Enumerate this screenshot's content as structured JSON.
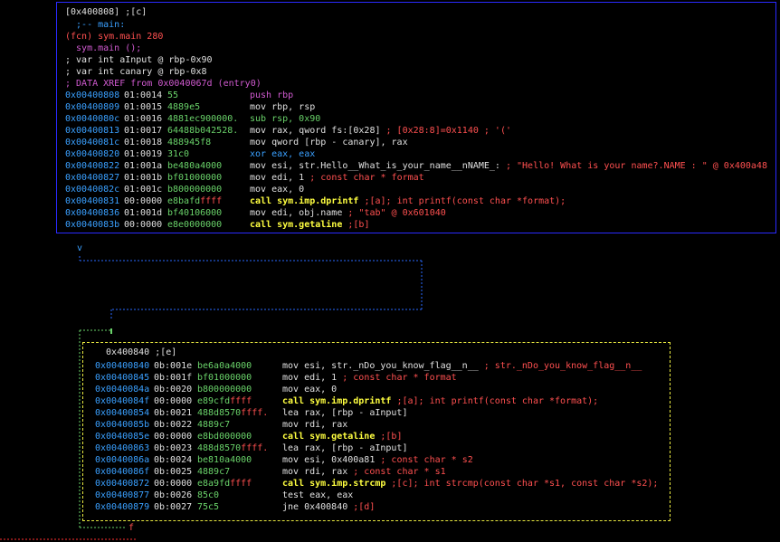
{
  "block1": {
    "header": "[0x400808] ;[c]",
    "main_label": "  ;-- main:",
    "fcn_line": "(fcn) sym.main 280",
    "sym_line": "  sym.main ();",
    "var1": "; var int aInput @ rbp-0x90",
    "var2": "; var int canary @ rbp-0x8",
    "xref": "; DATA XREF from 0x0040067d (entry0)",
    "rows": [
      {
        "addr": "0x00400808",
        "off": "01:0014",
        "bytes": "55",
        "ff": "",
        "mn": "push rbp",
        "mnclass": "c-mn-push",
        "cmt": ""
      },
      {
        "addr": "0x00400809",
        "off": "01:0015",
        "bytes": "4889e5",
        "ff": "",
        "mn": "mov rbp, rsp",
        "mnclass": "c-mn",
        "cmt": ""
      },
      {
        "addr": "0x0040080c",
        "off": "01:0016",
        "bytes": "4881ec900000.",
        "ff": "",
        "mn": "sub rsp, 0x90",
        "mnclass": "c-mn-sub",
        "cmt": ""
      },
      {
        "addr": "0x00400813",
        "off": "01:0017",
        "bytes": "64488b042528.",
        "ff": "",
        "mn": "mov rax, qword fs:[0x28]",
        "mnclass": "c-mn",
        "cmt": " ; [0x28:8]=0x1140 ; '('"
      },
      {
        "addr": "0x0040081c",
        "off": "01:0018",
        "bytes": "488945f8",
        "ff": "",
        "mn": "mov qword [rbp - canary], rax",
        "mnclass": "c-mn",
        "cmt": ""
      },
      {
        "addr": "0x00400820",
        "off": "01:0019",
        "bytes": "31c0",
        "ff": "",
        "mn": "xor eax, eax",
        "mnclass": "c-mn-xor",
        "cmt": ""
      },
      {
        "addr": "0x00400822",
        "off": "01:001a",
        "bytes": "be480a4000",
        "ff": "",
        "mn": "mov esi, str.Hello__What_is_your_name__nNAME_:",
        "mnclass": "c-mn",
        "cmt": " ; \"Hello! What is your name?.NAME : \" @ 0x400a48"
      },
      {
        "addr": "0x00400827",
        "off": "01:001b",
        "bytes": "bf01000000",
        "ff": "",
        "mn": "mov edi, 1",
        "mnclass": "c-mn",
        "cmt": " ; const char * format"
      },
      {
        "addr": "0x0040082c",
        "off": "01:001c",
        "bytes": "b800000000",
        "ff": "",
        "mn": "mov eax, 0",
        "mnclass": "c-mn",
        "cmt": ""
      },
      {
        "addr": "0x00400831",
        "off": "00:0000",
        "bytes": "e8bafd",
        "ff": "ffff",
        "mn": "call sym.imp.dprintf",
        "mnclass": "c-call",
        "cmt": " ;[a]; int printf(const char *format);"
      },
      {
        "addr": "0x00400836",
        "off": "01:001d",
        "bytes": "bf40106000",
        "ff": "",
        "mn": "mov edi, obj.name",
        "mnclass": "c-mn",
        "cmt": " ; \"tab\" @ 0x601040"
      },
      {
        "addr": "0x0040083b",
        "off": "00:0000",
        "bytes": "e8e0000000",
        "ff": "",
        "mn": "call sym.getaline",
        "mnclass": "c-call",
        "cmt": " ;[b]"
      }
    ]
  },
  "connector": {
    "v_label": "v",
    "f_label": "f"
  },
  "block2": {
    "header": "  0x400840 ;[e]",
    "rows": [
      {
        "addr": "0x00400840",
        "off": "0b:001e",
        "bytes": "be6a0a4000",
        "ff": "",
        "mn": "mov esi, str._nDo_you_know_flag__n__",
        "mnclass": "c-mn",
        "cmt": " ; str._nDo_you_know_flag__n__"
      },
      {
        "addr": "0x00400845",
        "off": "0b:001f",
        "bytes": "bf01000000",
        "ff": "",
        "mn": "mov edi, 1",
        "mnclass": "c-mn",
        "cmt": " ; const char * format"
      },
      {
        "addr": "0x0040084a",
        "off": "0b:0020",
        "bytes": "b800000000",
        "ff": "",
        "mn": "mov eax, 0",
        "mnclass": "c-mn",
        "cmt": ""
      },
      {
        "addr": "0x0040084f",
        "off": "00:0000",
        "bytes": "e89cfd",
        "ff": "ffff",
        "mn": "call sym.imp.dprintf",
        "mnclass": "c-call",
        "cmt": " ;[a]; int printf(const char *format);"
      },
      {
        "addr": "0x00400854",
        "off": "0b:0021",
        "bytes": "488d8570",
        "ff": "ffff.",
        "mn": "lea rax, [rbp - aInput]",
        "mnclass": "c-mn",
        "cmt": ""
      },
      {
        "addr": "0x0040085b",
        "off": "0b:0022",
        "bytes": "4889c7",
        "ff": "",
        "mn": "mov rdi, rax",
        "mnclass": "c-mn",
        "cmt": ""
      },
      {
        "addr": "0x0040085e",
        "off": "00:0000",
        "bytes": "e8bd000000",
        "ff": "",
        "mn": "call sym.getaline",
        "mnclass": "c-call",
        "cmt": " ;[b]"
      },
      {
        "addr": "0x00400863",
        "off": "0b:0023",
        "bytes": "488d8570",
        "ff": "ffff.",
        "mn": "lea rax, [rbp - aInput]",
        "mnclass": "c-mn",
        "cmt": ""
      },
      {
        "addr": "0x0040086a",
        "off": "0b:0024",
        "bytes": "be810a4000",
        "ff": "",
        "mn": "mov esi, 0x400a81",
        "mnclass": "c-mn",
        "cmt": " ; const char * s2"
      },
      {
        "addr": "0x0040086f",
        "off": "0b:0025",
        "bytes": "4889c7",
        "ff": "",
        "mn": "mov rdi, rax",
        "mnclass": "c-mn",
        "cmt": " ; const char * s1"
      },
      {
        "addr": "0x00400872",
        "off": "00:0000",
        "bytes": "e8a9fd",
        "ff": "ffff",
        "mn": "call sym.imp.strcmp",
        "mnclass": "c-call",
        "cmt": " ;[c]; int strcmp(const char *s1, const char *s2);"
      },
      {
        "addr": "0x00400877",
        "off": "0b:0026",
        "bytes": "85c0",
        "ff": "",
        "mn": "test eax, eax",
        "mnclass": "c-mn",
        "cmt": ""
      },
      {
        "addr": "0x00400879",
        "off": "0b:0027",
        "bytes": "75c5",
        "ff": "",
        "mn": "jne 0x400840",
        "mnclass": "c-mn",
        "cmt": " ;[d]"
      }
    ]
  }
}
